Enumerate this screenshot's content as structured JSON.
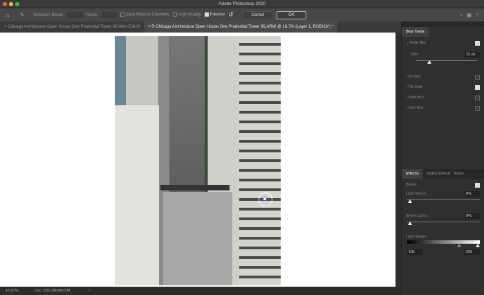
{
  "window": {
    "title": "Adobe Photoshop 2020"
  },
  "options_bar": {
    "selection_bleed_label": "Selection Bleed:",
    "focus_label": "Focus:",
    "save_mask_label": "Save Mask to Channels",
    "save_mask_checked": false,
    "high_quality_label": "High Quality",
    "high_quality_checked": false,
    "preview_label": "Preview",
    "preview_checked": true,
    "cancel_label": "Cancel",
    "ok_label": "OK"
  },
  "tabs": [
    {
      "label": "Chicago Architecture Open House One Prudential Tower 95 Web-Edit.tif",
      "active": false
    },
    {
      "label": "© Chicago Architecture Open House One Prudential Tower 95.ARW @ 16.7% (Layer 1, RGB/16*) *",
      "active": true
    }
  ],
  "status": {
    "zoom": "16.67%",
    "doc": "Doc: 235.3M/549.0M"
  },
  "blur_tools": {
    "title": "Blur Tools",
    "field_blur": {
      "label": "Field Blur",
      "checked": true,
      "blur_label": "Blur:",
      "blur_value": "15 px"
    },
    "items": [
      {
        "label": "Iris Blur",
        "checked": false
      },
      {
        "label": "Tilt-Shift",
        "checked": true
      },
      {
        "label": "Path Blur",
        "checked": false
      },
      {
        "label": "Spin Blur",
        "checked": false
      }
    ]
  },
  "effects": {
    "tabs": [
      "Effects",
      "Motion Effects",
      "Noise"
    ],
    "bokeh_label": "Bokeh",
    "bokeh_checked": true,
    "light_bokeh_label": "Light Bokeh:",
    "light_bokeh_value": "0%",
    "bokeh_color_label": "Bokeh Color:",
    "bokeh_color_value": "0%",
    "light_range_label": "Light Range:",
    "light_range_min": "191",
    "light_range_max": "255"
  }
}
